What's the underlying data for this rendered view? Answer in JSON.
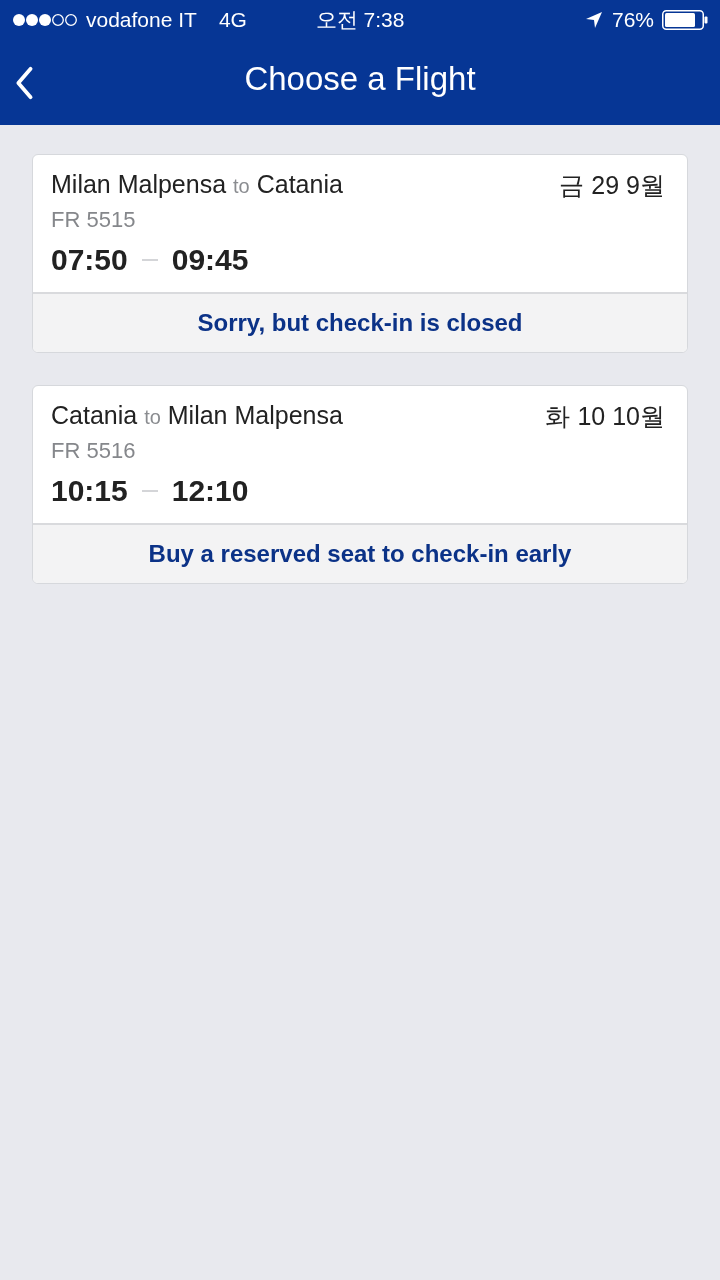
{
  "status_bar": {
    "carrier": "vodafone IT",
    "network": "4G",
    "time": "오전 7:38",
    "battery": "76%"
  },
  "nav_bar": {
    "title": "Choose a Flight"
  },
  "flights": [
    {
      "from": "Milan Malpensa",
      "connector": "to",
      "to": "Catania",
      "date": "금 29 9월",
      "flight_number": "FR 5515",
      "departure": "07:50",
      "arrival": "09:45",
      "footer": "Sorry, but check-in is closed"
    },
    {
      "from": "Catania",
      "connector": "to",
      "to": "Milan Malpensa",
      "date": "화 10 10월",
      "flight_number": "FR 5516",
      "departure": "10:15",
      "arrival": "12:10",
      "footer": "Buy a reserved seat to check-in early"
    }
  ]
}
